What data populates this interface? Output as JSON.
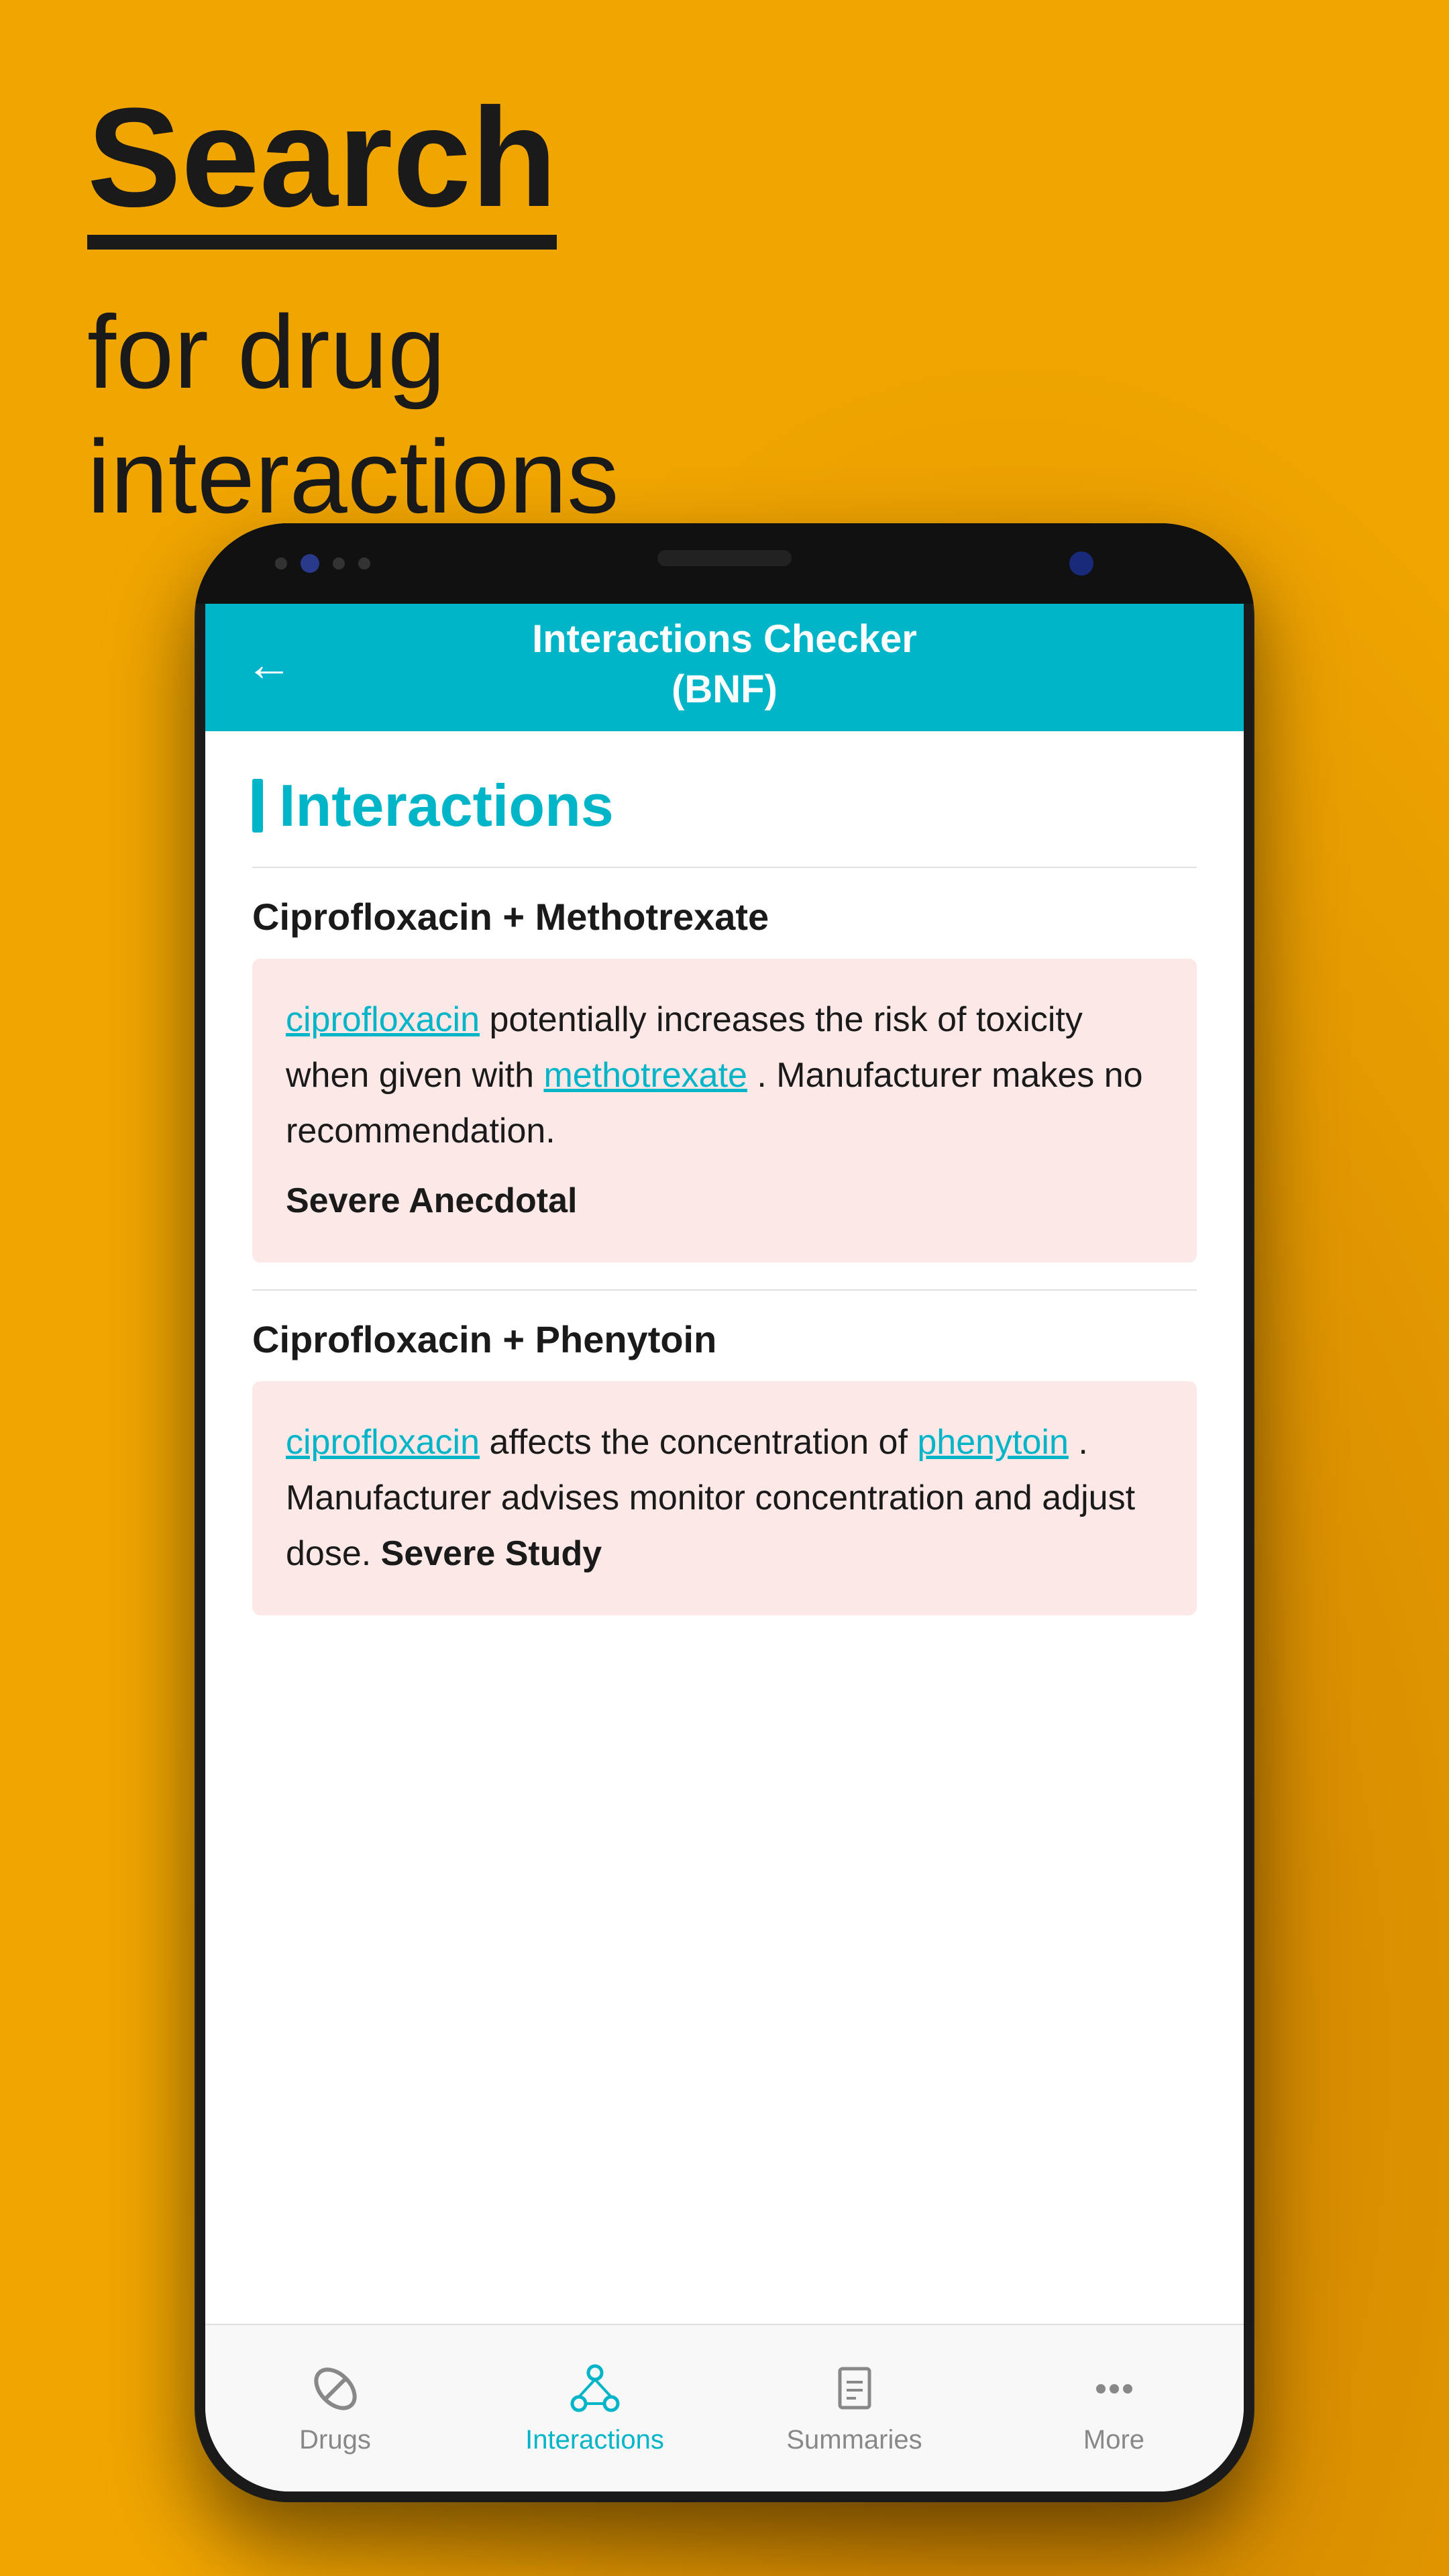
{
  "background": {
    "color": "#F0A500"
  },
  "header": {
    "search_label": "Search",
    "subtitle": "for drug\ninteractions"
  },
  "phone": {
    "app_header": {
      "title": "Interactions Checker\n(BNF)",
      "back_label": "←"
    },
    "screen": {
      "section_title": "Interactions",
      "interactions": [
        {
          "title": "Ciprofloxacin + Methotrexate",
          "drug1": "ciprofloxacin",
          "text_before": "",
          "description": " potentially increases the risk of toxicity when given with ",
          "drug2": "methotrexate",
          "text_after": ". Manufacturer makes no recommendation.",
          "severity": "Severe Anecdotal"
        },
        {
          "title": "Ciprofloxacin + Phenytoin",
          "drug1": "ciprofloxacin",
          "text_before": "",
          "description": " affects the concentration of ",
          "drug2": "phenytoin",
          "text_after": ". Manufacturer advises monitor concentration and adjust dose.",
          "severity": "Severe Study"
        }
      ]
    },
    "tab_bar": {
      "tabs": [
        {
          "id": "drugs",
          "label": "Drugs",
          "active": false
        },
        {
          "id": "interactions",
          "label": "Interactions",
          "active": true
        },
        {
          "id": "summaries",
          "label": "Summaries",
          "active": false
        },
        {
          "id": "more",
          "label": "More",
          "active": false
        }
      ]
    }
  }
}
